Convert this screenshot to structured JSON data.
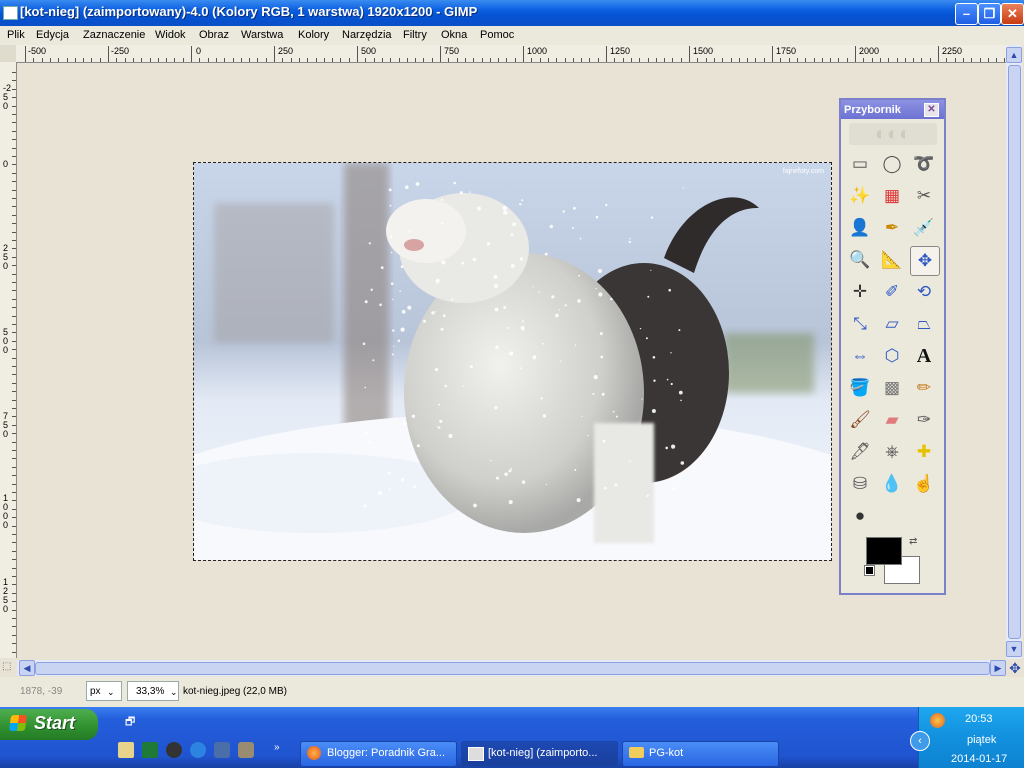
{
  "window": {
    "title": "[kot-nieg] (zaimportowany)-4.0 (Kolory RGB, 1 warstwa) 1920x1200 - GIMP"
  },
  "menu": [
    "Plik",
    "Edycja",
    "Zaznaczenie",
    "Widok",
    "Obraz",
    "Warstwa",
    "Kolory",
    "Narzędzia",
    "Filtry",
    "Okna",
    "Pomoc"
  ],
  "hruler_labels": [
    "-500",
    "-250",
    "0",
    "250",
    "500",
    "750",
    "1000",
    "1250",
    "1500",
    "1750",
    "2000",
    "2250"
  ],
  "vruler_labels": [
    "-250",
    "0",
    "250",
    "500",
    "750",
    "1000",
    "1250"
  ],
  "statusbar": {
    "coords": "1878, -39",
    "unit": "px",
    "zoom": "33,3%",
    "file_info": "kot-nieg.jpeg (22,0 MB)"
  },
  "image": {
    "watermark": "fajnefoty.com"
  },
  "toolbox": {
    "title": "Przybornik",
    "tools": [
      "rect-select-icon",
      "ellipse-select-icon",
      "free-select-icon",
      "fuzzy-select-icon",
      "color-select-icon",
      "scissors-icon",
      "foreground-select-icon",
      "paths-icon",
      "color-picker-icon",
      "zoom-icon",
      "measure-icon",
      "move-icon",
      "align-icon",
      "crop-icon",
      "rotate-icon",
      "scale-icon",
      "shear-icon",
      "perspective-icon",
      "flip-icon",
      "cage-icon",
      "text-icon",
      "bucket-fill-icon",
      "blend-icon",
      "pencil-icon",
      "paintbrush-icon",
      "eraser-icon",
      "airbrush-icon",
      "ink-icon",
      "clone-icon",
      "heal-icon",
      "perspective-clone-icon",
      "blur-icon",
      "smudge-icon",
      "dodge-burn-icon"
    ],
    "fg_color": "#000000",
    "bg_color": "#ffffff"
  },
  "taskbar": {
    "start": "Start",
    "buttons": [
      "Blogger: Poradnik Gra...",
      "[kot-nieg] (zaimporto...",
      "PG-kot"
    ],
    "clock": {
      "time": "20:53",
      "day": "piątek",
      "date": "2014-01-17"
    }
  }
}
